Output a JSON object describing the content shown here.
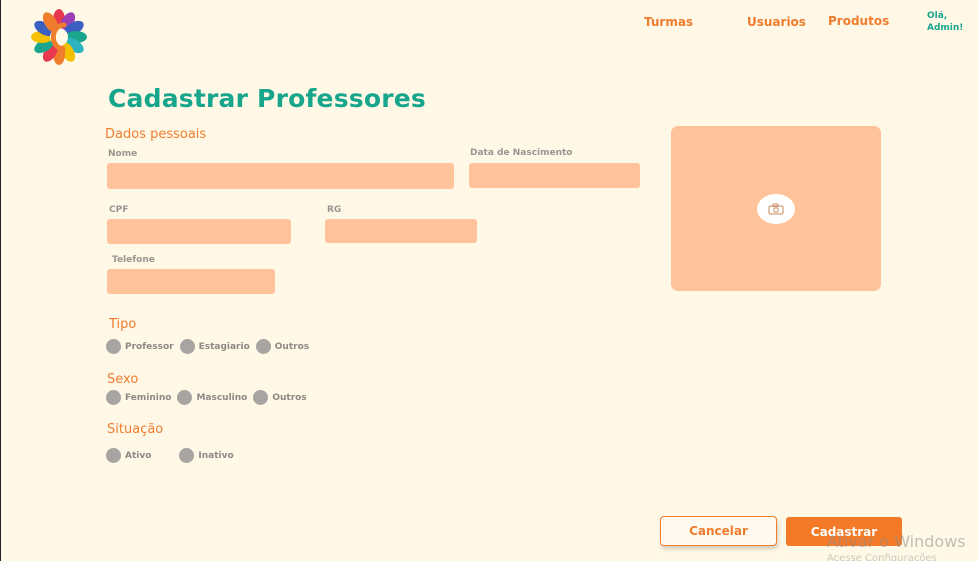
{
  "header": {
    "nav": [
      "Turmas",
      "Usuarios",
      "Produtos"
    ],
    "greeting_line1": "Olá,",
    "greeting_line2": "Admin!"
  },
  "page": {
    "title": "Cadastrar Professores"
  },
  "form": {
    "section_personal": "Dados pessoais",
    "labels": {
      "nome": "Nome",
      "nascimento": "Data de Nascimento",
      "cpf": "CPF",
      "rg": "RG",
      "telefone": "Telefone"
    },
    "values": {
      "nome": "",
      "nascimento": "",
      "cpf": "",
      "rg": "",
      "telefone": ""
    },
    "tipo": {
      "label": "Tipo",
      "options": [
        "Professor",
        "Estagiario",
        "Outros"
      ]
    },
    "sexo": {
      "label": "Sexo",
      "options": [
        "Feminino",
        "Masculino",
        "Outros"
      ]
    },
    "situacao": {
      "label": "Situação",
      "options": [
        "Ativo",
        "Inativo"
      ]
    }
  },
  "photo": {
    "icon": "camera-icon"
  },
  "actions": {
    "cancel_label": "Cancelar",
    "submit_label": "Cadastrar"
  },
  "os_overlay": {
    "watermark_line1": "Ativar o Windows",
    "watermark_line2": "Acesse Configurações"
  },
  "colors": {
    "background": "#fff8e7",
    "accent_orange": "#f07d2e",
    "title_teal": "#17a58c",
    "field_fill": "#ffc39b",
    "radio_gray": "#a8a4a1"
  }
}
